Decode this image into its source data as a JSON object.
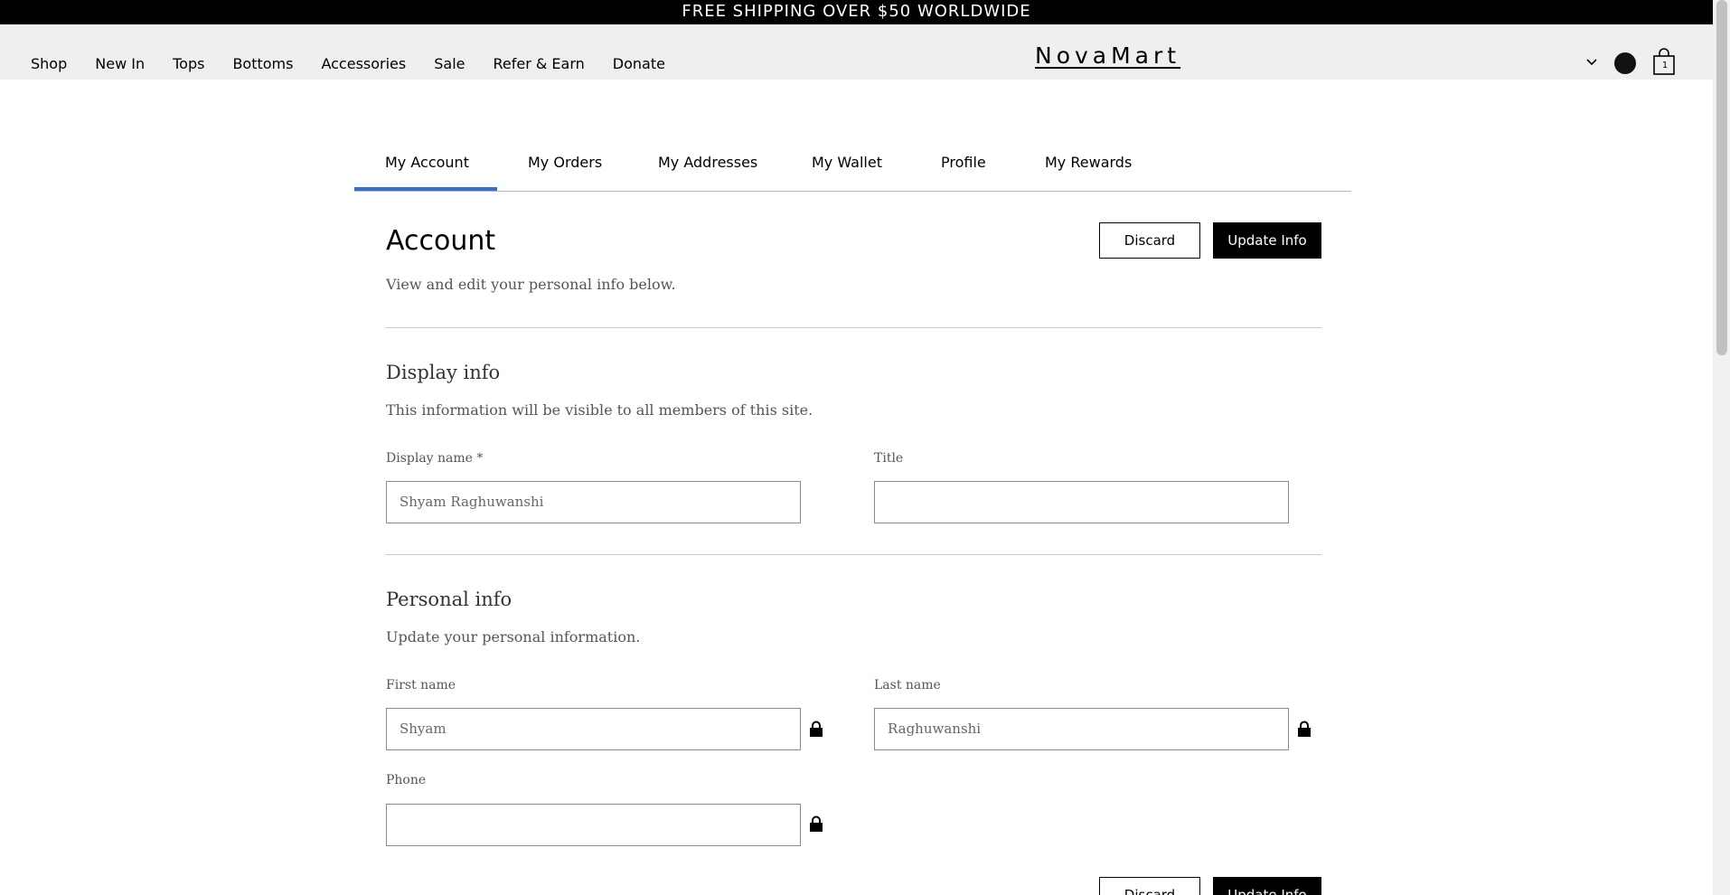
{
  "announcement": "FREE SHIPPING OVER $50 WORLDWIDE",
  "header": {
    "nav": [
      "Shop",
      "New In",
      "Tops",
      "Bottoms",
      "Accessories",
      "Sale",
      "Refer & Earn",
      "Donate"
    ],
    "logo": "NovaMart",
    "cart_count": "1"
  },
  "tabs": [
    "My Account",
    "My Orders",
    "My Addresses",
    "My Wallet",
    "Profile",
    "My Rewards"
  ],
  "active_tab": "My Account",
  "account": {
    "title": "Account",
    "subtitle": "View and edit your personal info below.",
    "discard_label": "Discard",
    "update_label": "Update Info"
  },
  "display_info": {
    "title": "Display info",
    "description": "This information will be visible to all members of this site.",
    "display_name_label": "Display name *",
    "display_name_value": "Shyam Raghuwanshi",
    "title_label": "Title",
    "title_value": ""
  },
  "personal_info": {
    "title": "Personal info",
    "description": "Update your personal information.",
    "first_name_label": "First name",
    "first_name_value": "Shyam",
    "last_name_label": "Last name",
    "last_name_value": "Raghuwanshi",
    "phone_label": "Phone",
    "phone_value": ""
  },
  "colors": {
    "accent": "#2f6fd6",
    "header_bg": "#efefef",
    "announcement_bg": "#000000"
  },
  "icons": [
    "chevron-down-icon",
    "avatar",
    "shopping-bag-icon",
    "lock-icon"
  ]
}
